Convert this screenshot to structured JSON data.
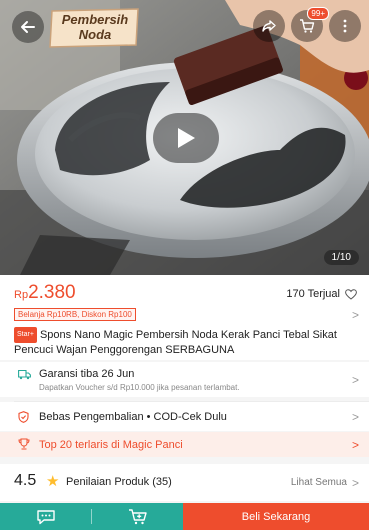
{
  "media": {
    "label": "Pembersih\nNoda",
    "cart_badge": "99+",
    "pager": "1/10"
  },
  "product": {
    "currency": "Rp",
    "price": "2.380",
    "sold": "170 Terjual",
    "promo": "Belanja Rp10RB, Diskon Rp100",
    "star_badge": "Star+",
    "title": "Spons Nano Magic Pembersih Noda Kerak Panci Tebal Sikat Pencuci Wajan Penggorengan SERBAGUNA"
  },
  "shipping": {
    "title": "Garansi tiba 26 Jun",
    "subtitle": "Dapatkan Voucher s/d Rp10.000 jika pesanan terlambat."
  },
  "returns": {
    "text": "Bebas Pengembalian  •  COD-Cek Dulu"
  },
  "bestseller": {
    "text": "Top 20 terlaris di Magic Panci"
  },
  "rating": {
    "score": "4.5",
    "label": "Penilaian Produk (35)",
    "see_all": "Lihat Semua"
  },
  "bottom_bar": {
    "buy_label": "Beli Sekarang"
  },
  "colors": {
    "accent": "#ee4d2d",
    "teal": "#26aa99",
    "star": "#ffbd2e"
  },
  "icons": [
    "back-arrow-icon",
    "share-icon",
    "cart-icon",
    "more-icon",
    "play-icon",
    "heart-icon",
    "truck-icon",
    "shield-icon",
    "trophy-icon",
    "star-icon",
    "chat-icon",
    "add-to-cart-icon",
    "chevron-right-icon"
  ]
}
